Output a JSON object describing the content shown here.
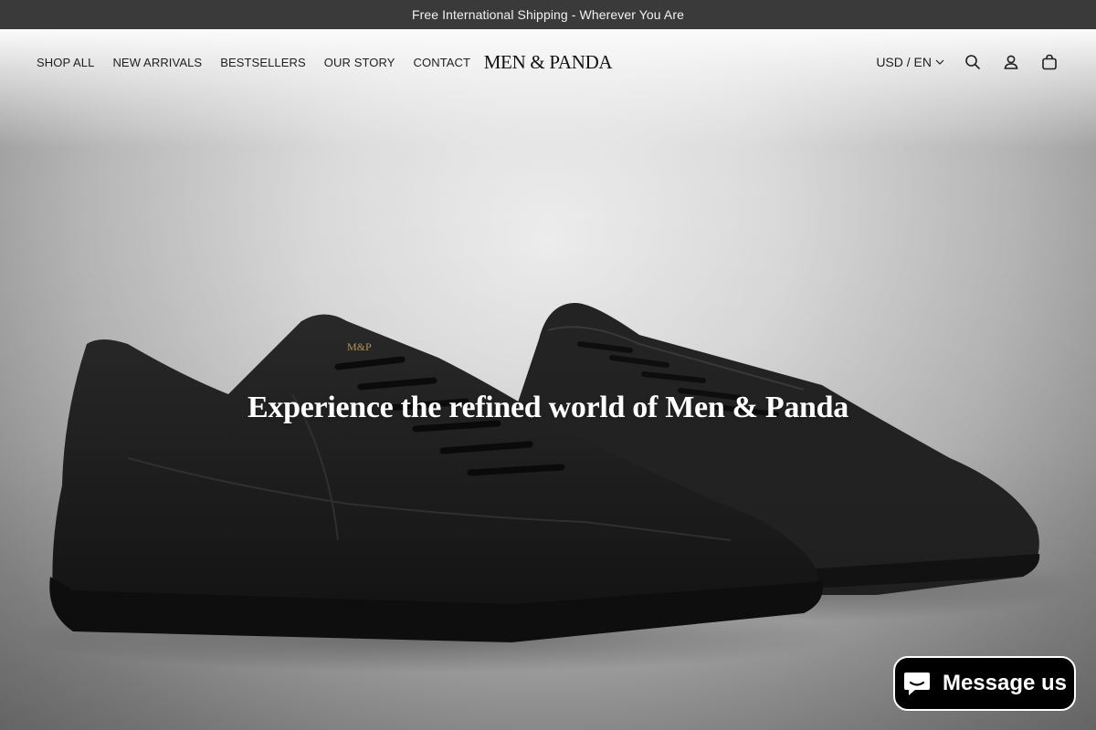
{
  "announcement": {
    "text": "Free International Shipping - Wherever You Are"
  },
  "header": {
    "nav": [
      {
        "label": "SHOP ALL"
      },
      {
        "label": "NEW ARRIVALS"
      },
      {
        "label": "BESTSELLERS"
      },
      {
        "label": "OUR STORY"
      },
      {
        "label": "CONTACT"
      }
    ],
    "logo": "MEN & PANDA",
    "locale": "USD / EN",
    "icons": [
      "chevron-down-icon",
      "search-icon",
      "account-icon",
      "cart-icon"
    ]
  },
  "hero": {
    "heading": "Experience the refined world of Men & Panda"
  },
  "chat": {
    "label": "Message us",
    "icon": "chat-bubble-icon"
  },
  "colors": {
    "announcement_bg": "#3a3a3a",
    "chat_bg": "#000000",
    "shoe": "#1c1c1c"
  }
}
